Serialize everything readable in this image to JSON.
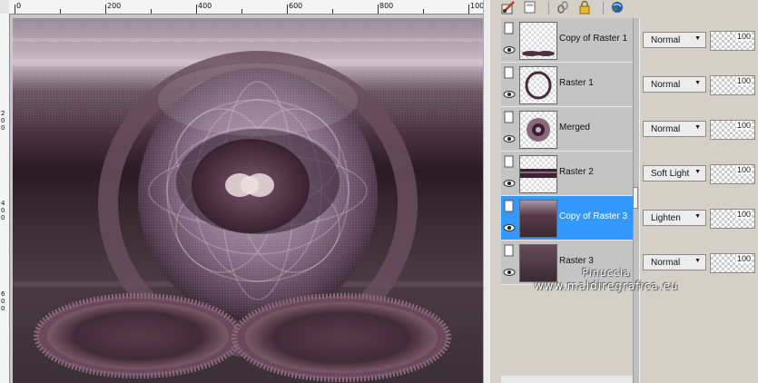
{
  "ruler": {
    "top_labels": [
      "0",
      "200",
      "400",
      "600",
      "800",
      "100"
    ],
    "left_labels": [
      "2",
      "0",
      "0",
      "4",
      "0",
      "0",
      "6",
      "0",
      "0"
    ]
  },
  "toolbar": {
    "icons": [
      "brush-layer-icon",
      "new-layer-icon",
      "link-icon",
      "lock-icon",
      "globe-visibility-icon"
    ]
  },
  "layers": [
    {
      "name": "Copy of Raster 1",
      "blend_mode": "Normal",
      "opacity": "100",
      "selected": false
    },
    {
      "name": "Raster 1",
      "blend_mode": "Normal",
      "opacity": "100",
      "selected": false
    },
    {
      "name": "Merged",
      "blend_mode": "Normal",
      "opacity": "100",
      "selected": false
    },
    {
      "name": "Raster 2",
      "blend_mode": "Soft Light",
      "opacity": "100",
      "selected": false
    },
    {
      "name": "Copy of Raster 3",
      "blend_mode": "Lighten",
      "opacity": "100",
      "selected": true
    },
    {
      "name": "Raster 3",
      "blend_mode": "Normal",
      "opacity": "100",
      "selected": false
    }
  ],
  "watermark": {
    "line1": "Pinuccia",
    "line2": "www.maldiregrafica.eu"
  },
  "colors": {
    "selection": "#3399ff",
    "canvas_dark": "#3a2a33",
    "canvas_mauve": "#7a5a6c"
  }
}
